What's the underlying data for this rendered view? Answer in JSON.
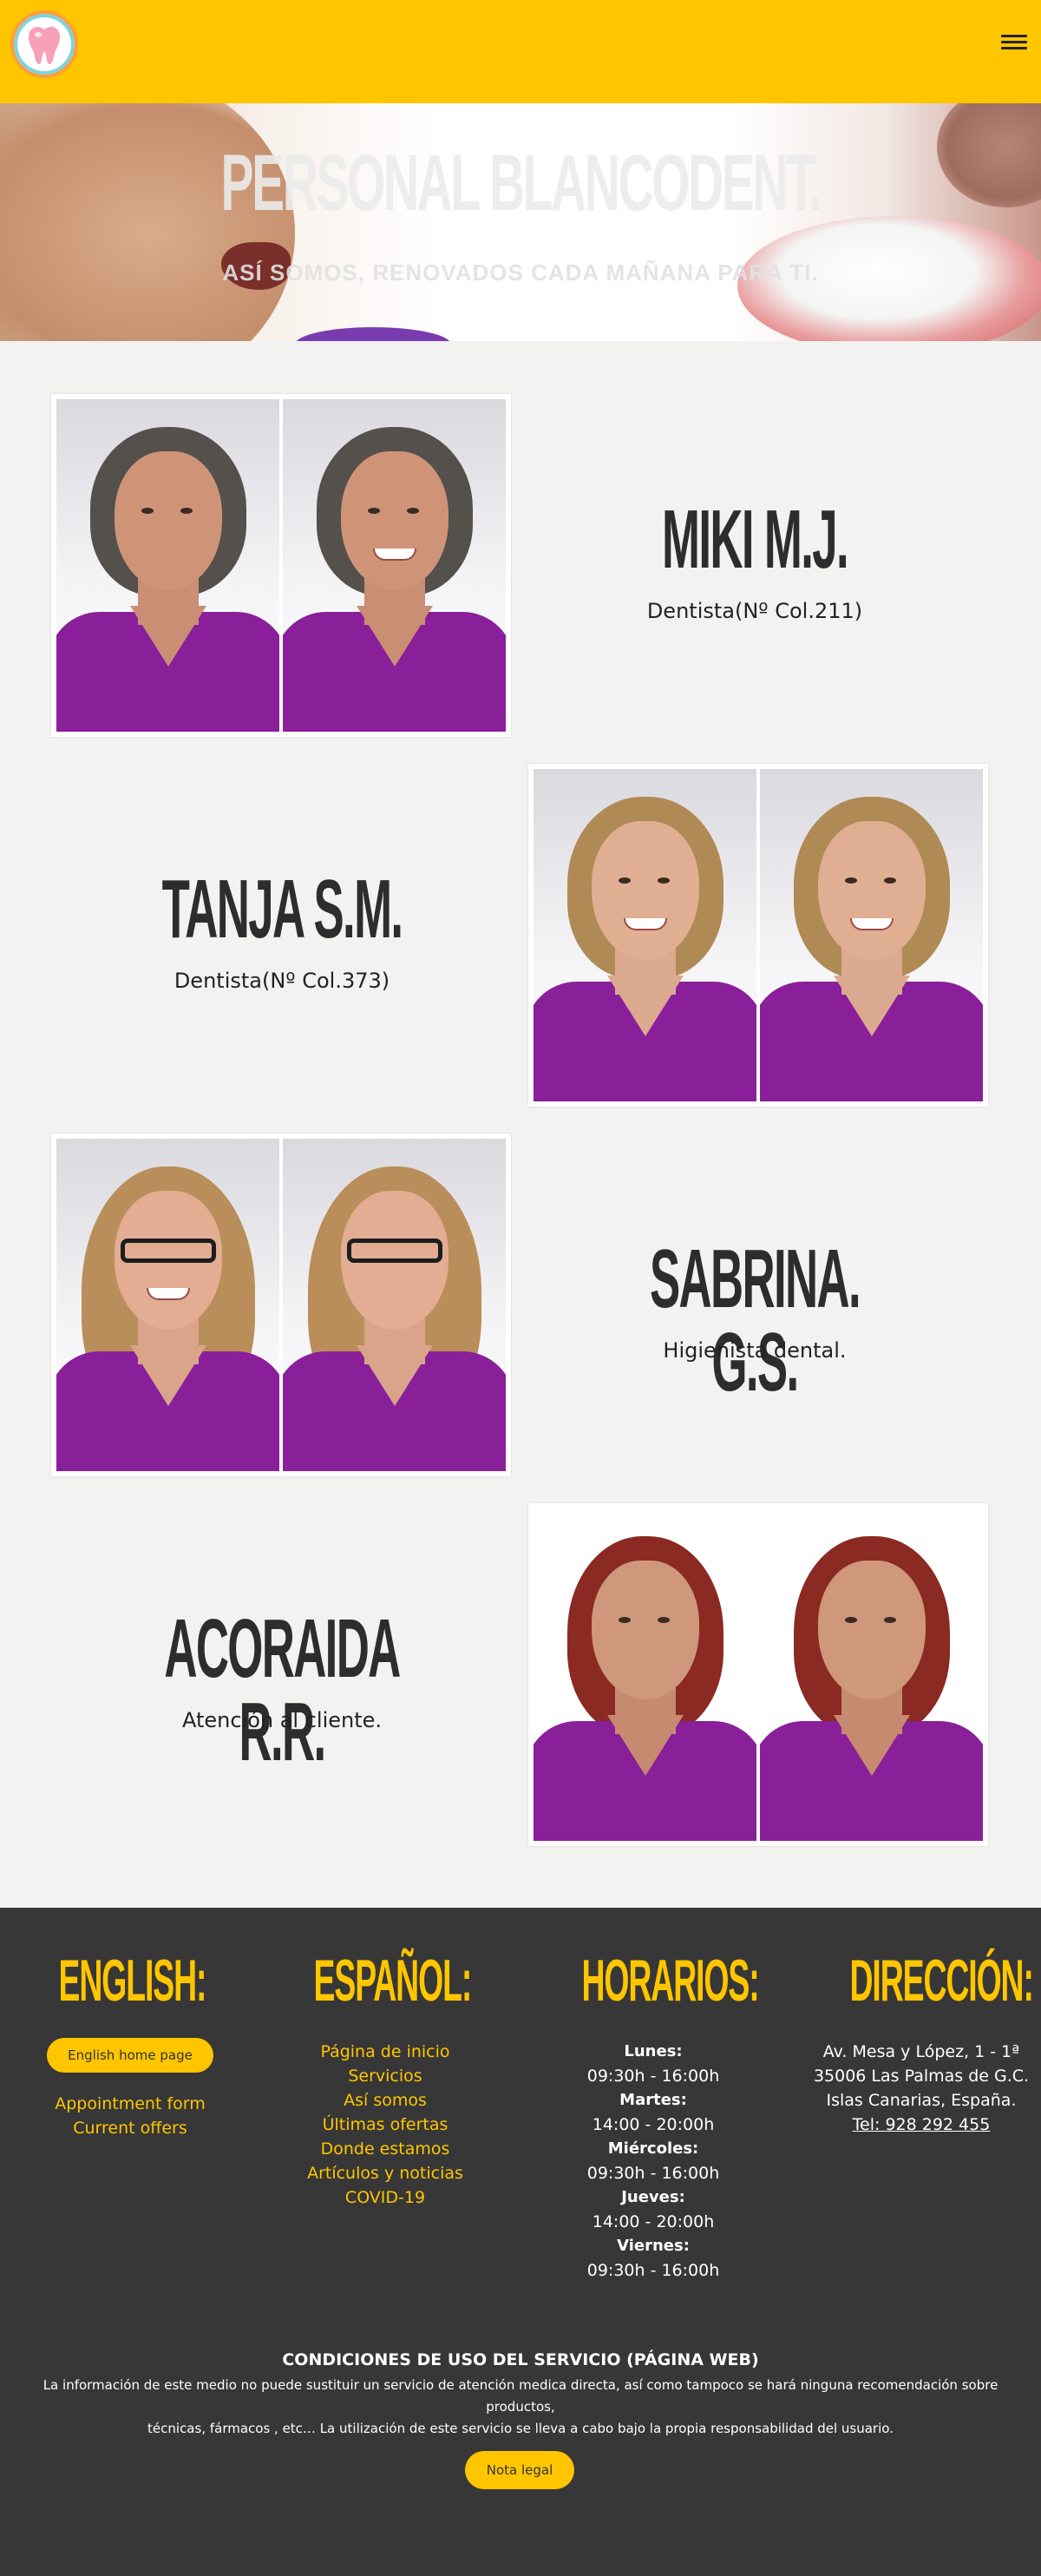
{
  "colors": {
    "brand_yellow": "#ffc600",
    "footer_bg": "#373737",
    "scrub_purple": "#8a1f9a",
    "page_bg": "#f2f2f1"
  },
  "header": {
    "logo_icon": "tooth-logo-icon",
    "menu_icon": "hamburger-menu-icon"
  },
  "hero": {
    "title": "PERSONAL BLANCODENT.",
    "subtitle": "ASÍ SOMOS, RENOVADOS CADA MAÑANA PARA TI."
  },
  "staff": [
    {
      "name": "MIKI M.J.",
      "role": "Dentista(Nº Col.211)"
    },
    {
      "name": "TANJA S.M.",
      "role": "Dentista(Nº Col.373)"
    },
    {
      "name": "SABRINA. G.S.",
      "role": "Higienista dental."
    },
    {
      "name": "ACORAIDA R.R.",
      "role": "Atención al cliente."
    }
  ],
  "footer": {
    "english": {
      "title": "ENGLISH:",
      "button": "English home page",
      "links": [
        "Appointment form",
        "Current offers"
      ]
    },
    "espanol": {
      "title": "ESPAÑOL:",
      "links": [
        "Página de inicio",
        "Servicios",
        "Así somos",
        "Últimas ofertas",
        "Donde estamos",
        "Artículos y noticias",
        "COVID-19"
      ]
    },
    "horarios": {
      "title": "HORARIOS:",
      "lines": [
        "Lunes:",
        "09:30h - 16:00h",
        "Martes:",
        "14:00 - 20:00h",
        "Miércoles:",
        "09:30h - 16:00h",
        "Jueves:",
        "14:00 - 20:00h",
        "Viernes:",
        "09:30h - 16:00h"
      ]
    },
    "direccion": {
      "title": "DIRECCIÓN:",
      "lines": [
        "Av. Mesa y López, 1 - 1ª",
        "35006 Las Palmas de G.C.",
        "Islas Canarias, España."
      ],
      "phone": "Tel: 928 292 455"
    },
    "conditions": {
      "title": "CONDICIONES DE USO DEL SERVICIO (PÁGINA WEB)",
      "line1": "La información de este medio no puede sustituir un servicio de atención medica directa, así como tampoco se hará ninguna recomendación sobre productos,",
      "line2": "técnicas, fármacos , etc… La utilización de este servicio se lleva a cabo bajo la propia responsabilidad del usuario."
    },
    "legal_button": "Nota legal"
  }
}
